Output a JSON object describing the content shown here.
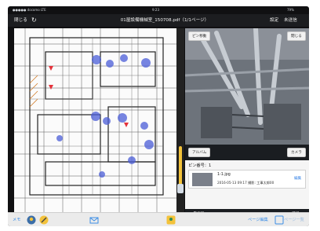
{
  "statusbar": {
    "carrier": "●●●●● docomo LTE",
    "time": "9:23",
    "battery": "79%"
  },
  "titlebar": {
    "close": "閉じる",
    "title": "01屋設備機械室_150708.pdf（1/1ページ）",
    "settings": "設定",
    "unsent": "未送信"
  },
  "photo_panel": {
    "pin_move": "ピン移動",
    "close": "閉じる",
    "album": "アルバム",
    "camera": "カメラ"
  },
  "info": {
    "pin_label": "ピン番号：1",
    "filename": "1-1.jpg",
    "meta": "2016-05-13 09:17  撮影: 工事太郎00",
    "edit": "編集",
    "list_update": "一覧更新",
    "select": "選択"
  },
  "toolbar": {
    "memo": "メモ",
    "page_edit": "ページ編集",
    "page_list": "ページ一覧"
  },
  "icons": [
    "refresh-icon",
    "pin-tool-icon",
    "pencil-icon",
    "mail-icon",
    "location-pin-icon",
    "page-edit-icon"
  ]
}
